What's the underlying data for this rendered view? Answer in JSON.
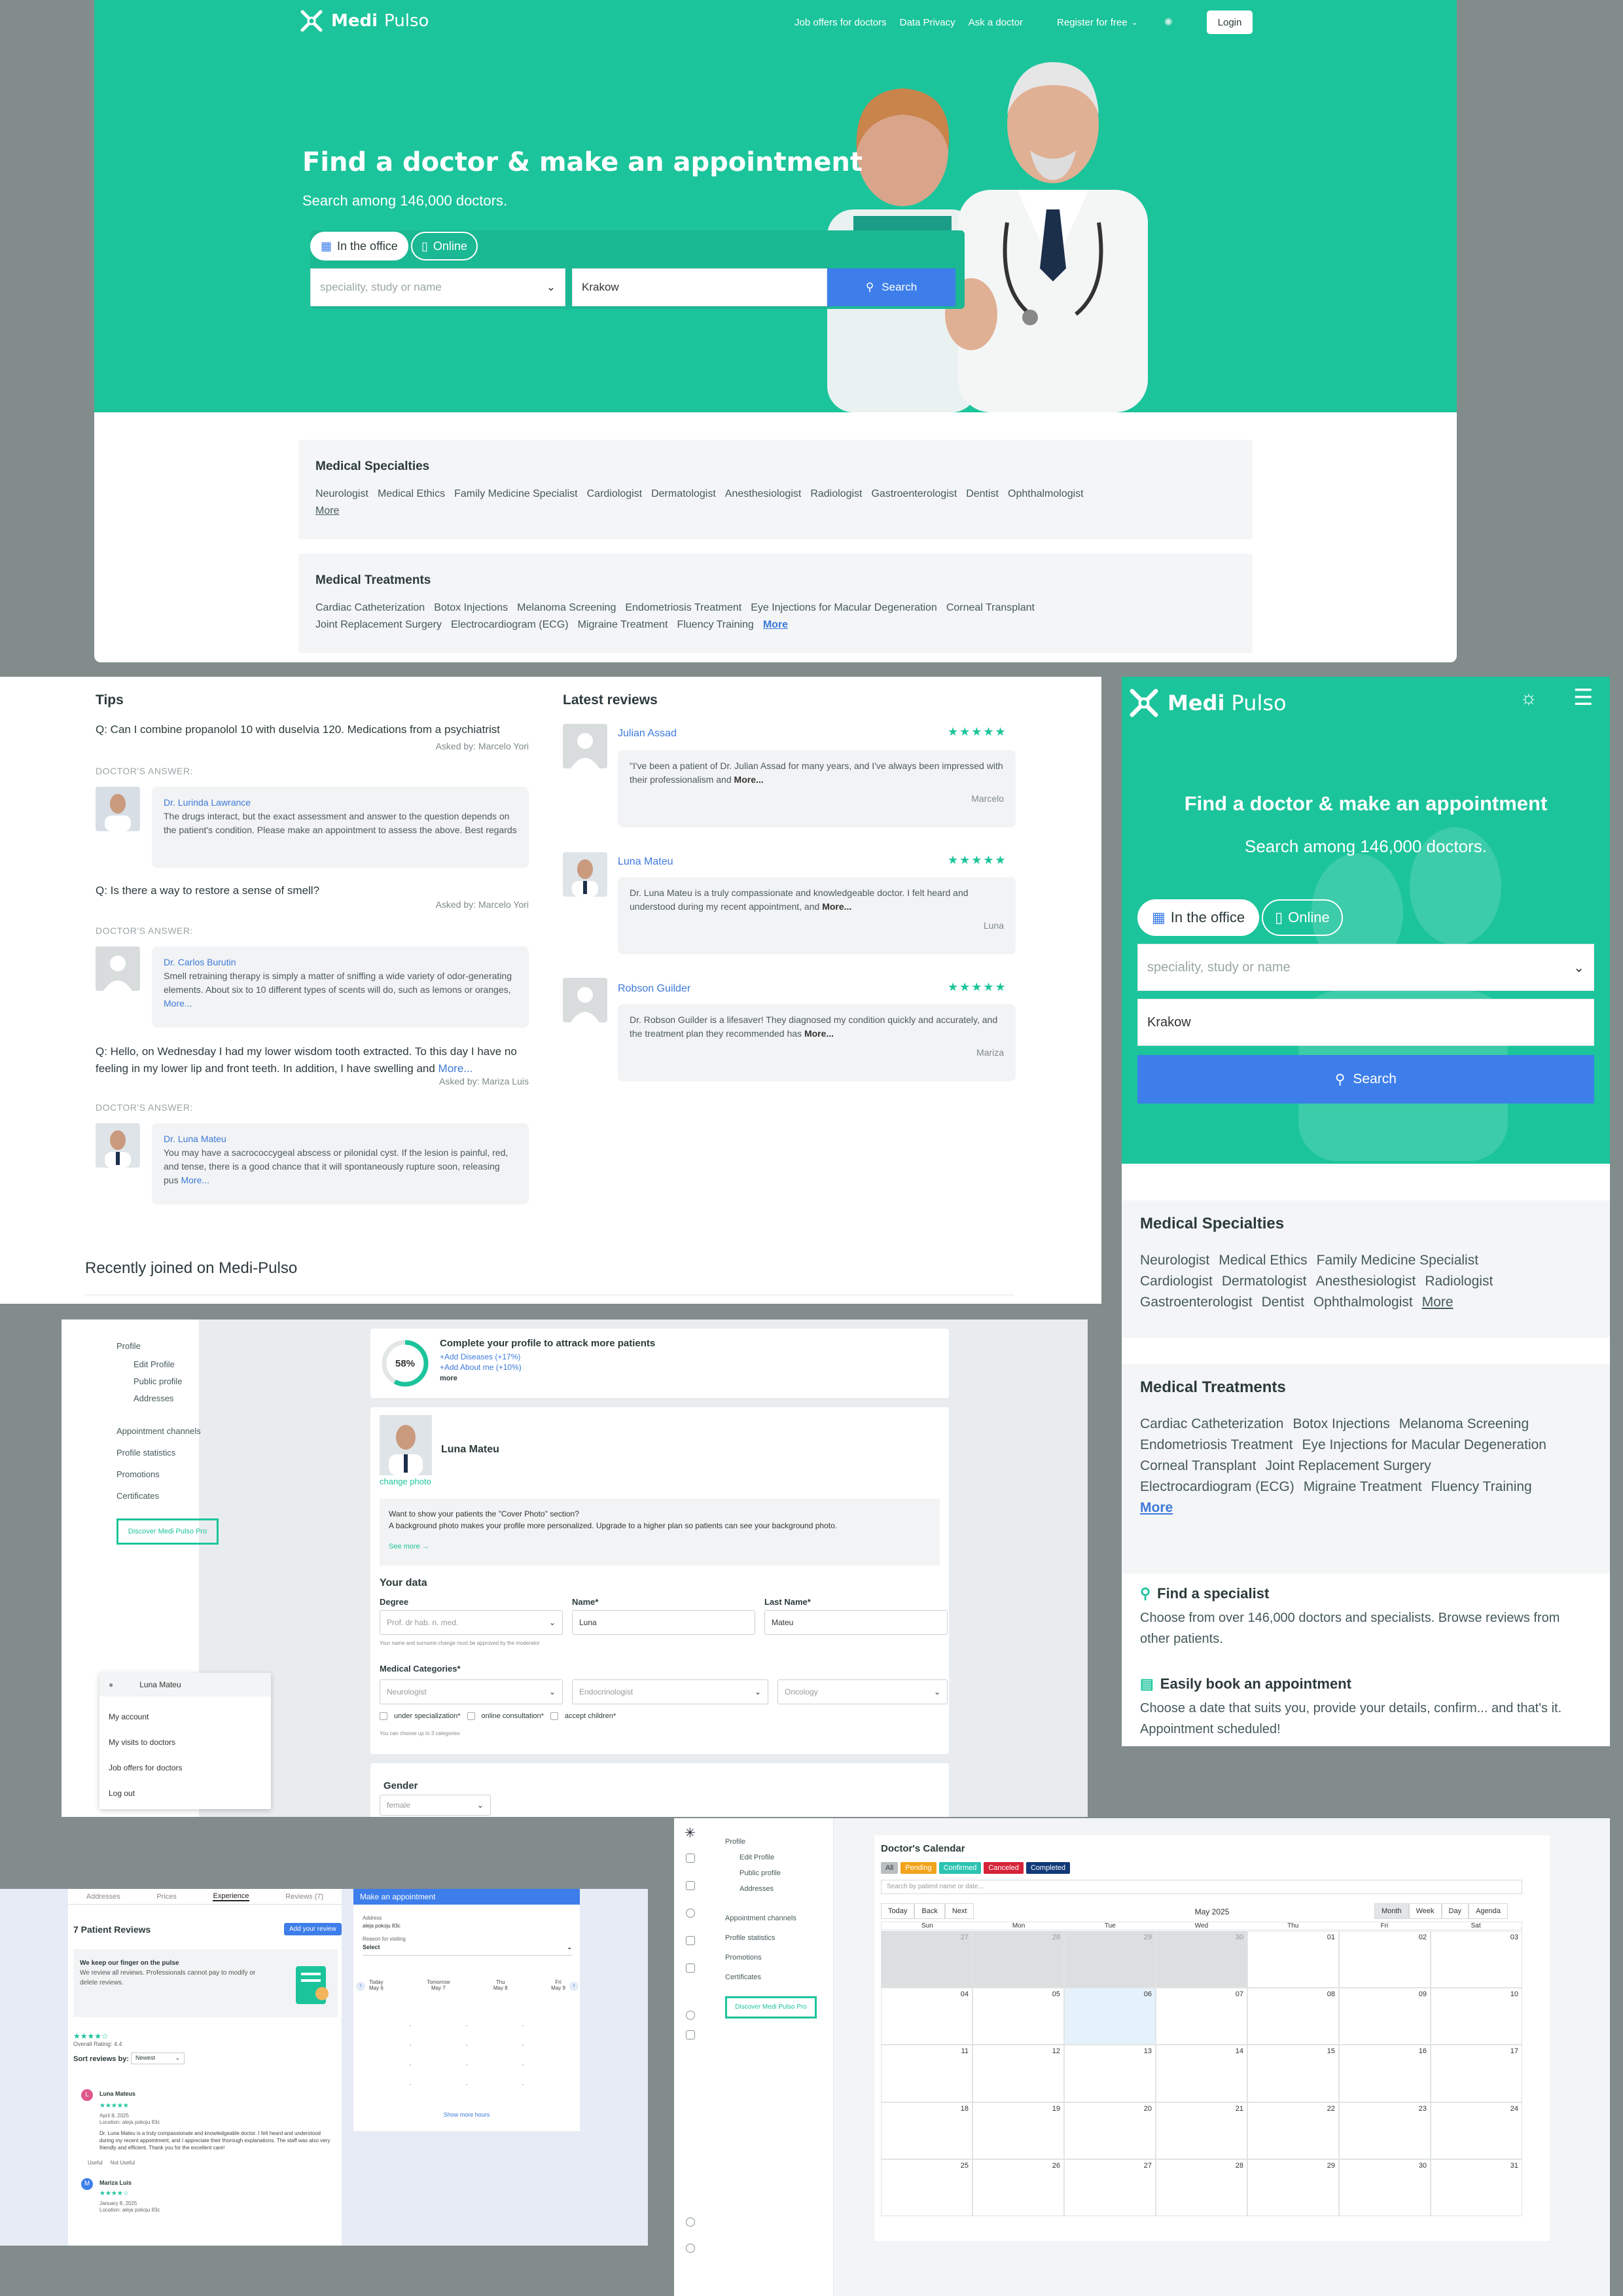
{
  "hero": {
    "brand_bold": "Medi",
    "brand_light": "Pulso",
    "nav": [
      "Job offers for doctors",
      "Data Privacy",
      "Ask a doctor"
    ],
    "register": "Register for free",
    "login": "Login",
    "title": "Find a doctor & make an appointment",
    "subtitle": "Search among 146,000 doctors.",
    "tab_office": "In the office",
    "tab_online": "Online",
    "speciality_placeholder": "speciality, study or name",
    "city": "Krakow",
    "search": "Search"
  },
  "specialties": {
    "title": "Medical Specialties",
    "items": [
      "Neurologist",
      "Medical Ethics",
      "Family Medicine Specialist",
      "Cardiologist",
      "Dermatologist",
      "Anesthesiologist",
      "Radiologist",
      "Gastroenterologist",
      "Dentist",
      "Ophthalmologist"
    ],
    "more": "More"
  },
  "treatments": {
    "title": "Medical Treatments",
    "items": [
      "Cardiac Catheterization",
      "Botox Injections",
      "Melanoma Screening",
      "Endometriosis Treatment",
      "Eye Injections for Macular Degeneration",
      "Corneal Transplant",
      "Joint Replacement Surgery",
      "Electrocardiogram (ECG)",
      "Migraine Treatment",
      "Fluency Training"
    ],
    "more": "More"
  },
  "tips": {
    "title": "Tips",
    "answer_label": "DOCTOR'S ANSWER:",
    "items": [
      {
        "q": "Q: Can I combine propanolol 10 with duselvia 120. Medications from a psychiatrist",
        "asked": "Asked by: Marcelo Yori",
        "doctor": "Dr. Lurinda Lawrance",
        "answer": "The drugs interact, but the exact assessment and answer to the question depends on the patient's condition. Please make an appointment to assess the above. Best regards",
        "more": ""
      },
      {
        "q": "Q: Is there a way to restore a sense of smell?",
        "asked": "Asked by: Marcelo Yori",
        "doctor": "Dr. Carlos Burutin",
        "answer": "Smell retraining therapy is simply a matter of sniffing a wide variety of odor-generating elements. About six to 10 different types of scents will do, such as lemons or oranges,",
        "more": "More..."
      },
      {
        "q": "Q: Hello, on Wednesday I had my lower wisdom tooth extracted. To this day I have no feeling in my lower lip and front teeth. In addition, I have swelling and",
        "q_more": "More...",
        "asked": "Asked by: Mariza Luis",
        "doctor": "Dr. Luna Mateu",
        "answer": "You may have a sacrococcygeal abscess or pilonidal cyst. If the lesion is painful, red, and tense, there is a good chance that it will spontaneously rupture soon, releasing pus",
        "more": "More..."
      }
    ]
  },
  "reviews": {
    "title": "Latest reviews",
    "items": [
      {
        "name": "Julian Assad",
        "stars": "★★★★★",
        "text": "\"I've been a patient of Dr. Julian Assad for many years, and I've always been impressed with their professionalism and",
        "more": "More...",
        "by": "Marcelo"
      },
      {
        "name": "Luna Mateu",
        "stars": "★★★★★",
        "text": "Dr. Luna Mateu is a truly compassionate and knowledgeable doctor. I felt heard and understood during my recent appointment, and",
        "more": "More...",
        "by": "Luna"
      },
      {
        "name": "Robson Guilder",
        "stars": "★★★★★",
        "text": "Dr. Robson Guilder is a lifesaver! They diagnosed my condition quickly and accurately, and the treatment plan they recommended has",
        "more": "More...",
        "by": "Mariza"
      }
    ]
  },
  "recent": {
    "title": "Recently joined on Medi-Pulso"
  },
  "mobile": {
    "find_title": "Find a specialist",
    "find_text": "Choose from over 146,000 doctors and specialists. Browse reviews from other patients.",
    "book_title": "Easily book an appointment",
    "book_text": "Choose a date that suits you, provide your details, confirm... and that's it. Appointment scheduled!"
  },
  "profile": {
    "nav": {
      "profile": "Profile",
      "edit": "Edit Profile",
      "public": "Public profile",
      "addresses": "Addresses",
      "channels": "Appointment channels",
      "stats": "Profile statistics",
      "promotions": "Promotions",
      "certificates": "Certificates",
      "pro": "Discover Medi Pulso Pro"
    },
    "menu": {
      "user": "Luna Mateu",
      "account": "My account",
      "visits": "My visits to doctors",
      "jobs": "Job offers for doctors",
      "logout": "Log out"
    },
    "complete": {
      "pct": "58%",
      "percent": 58,
      "title": "Complete your profile to attrack more patients",
      "add1": "+Add Diseases (+17%)",
      "add2": "+Add About me (+10%)",
      "more": "more"
    },
    "name": "Luna Mateu",
    "change_photo": "change photo",
    "cover_title": "Want to show your patients the \"Cover Photo\" section?",
    "cover_text": "A background photo makes your profile more personalized. Upgrade to a higher plan so patients can see your background photo.",
    "see_more": "See more →",
    "your_data": "Your data",
    "degree_label": "Degree",
    "degree_ph": "Prof. dr hab. n. med.",
    "name_label": "Name*",
    "name_val": "Luna",
    "last_label": "Last Name*",
    "last_val": "Mateu",
    "degree_note": "Your name and surname change must be approved by the moderator",
    "cat_label": "Medical Categories*",
    "cat1": "Neurologist",
    "cat2": "Endocrinologist",
    "cat3": "Oncology",
    "chk1": "under specialization*",
    "chk2": "online consultation*",
    "chk3": "accept children*",
    "cat_note": "You can choose up to 3 categories",
    "gender_label": "Gender",
    "gender_val": "female"
  },
  "patient_reviews": {
    "tabs": [
      "Addresses",
      "Prices",
      "Experience",
      "Reviews (7)"
    ],
    "title": "7 Patient Reviews",
    "add": "Add your review",
    "info_title": "We keep our finger on the pulse",
    "info_text": "We review all reviews. Professionals cannot pay to modify or delete reviews.",
    "overall": "Overall Rating: 4.4",
    "stars": "★★★★☆",
    "sort_label": "Sort reviews by:",
    "sort_val": "Newest",
    "r1": {
      "initial": "L",
      "name": "Luna Mateus",
      "stars": "★★★★★",
      "date": "April 8, 2025",
      "loc": "Location: aleja pokoju 83c",
      "text": "Dr. Luna Mateu is a truly compassionate and knowledgeable doctor. I felt heard and understood during my recent appointment, and I appreciate their thorough explanations. The staff was also very friendly and efficient. Thank you for the excellent care!",
      "useful": "Useful",
      "not_useful": "Not Useful"
    },
    "r2": {
      "initial": "M",
      "name": "Mariza Luis",
      "stars": "★★★★☆",
      "date": "January 8, 2025",
      "loc": "Location: aleja pokoju 83c"
    },
    "appt": {
      "title": "Make an appointment",
      "address_label": "Address",
      "address": "aleja pokoju 83c",
      "reason_label": "Reason for visiting",
      "select": "Select",
      "days": [
        {
          "d": "Today",
          "n": "May 6"
        },
        {
          "d": "Tomorrow",
          "n": "May 7"
        },
        {
          "d": "Thu",
          "n": "May 8"
        },
        {
          "d": "Fri",
          "n": "May 9"
        }
      ],
      "show_more": "Show more hours"
    }
  },
  "calendar": {
    "title": "Doctor's Calendar",
    "filters": [
      "All",
      "Pending",
      "Confirmed",
      "Canceled",
      "Completed"
    ],
    "search_ph": "Search by patient name or date...",
    "today": "Today",
    "back": "Back",
    "next": "Next",
    "month_label": "May 2025",
    "views": [
      "Month",
      "Week",
      "Day",
      "Agenda"
    ],
    "weekdays": [
      "Sun",
      "Mon",
      "Tue",
      "Wed",
      "Thu",
      "Fri",
      "Sat"
    ],
    "days": [
      "27",
      "28",
      "29",
      "30",
      "01",
      "02",
      "03",
      "04",
      "05",
      "06",
      "07",
      "08",
      "09",
      "10",
      "11",
      "12",
      "13",
      "14",
      "15",
      "16",
      "17",
      "18",
      "19",
      "20",
      "21",
      "22",
      "23",
      "24",
      "25",
      "26",
      "27",
      "28",
      "29",
      "30",
      "31"
    ],
    "colors": {
      "pending": "#f2a31b",
      "confirmed": "#2cc3b2",
      "canceled": "#d6233a",
      "completed": "#123a78",
      "all": "#b9bec0"
    }
  }
}
